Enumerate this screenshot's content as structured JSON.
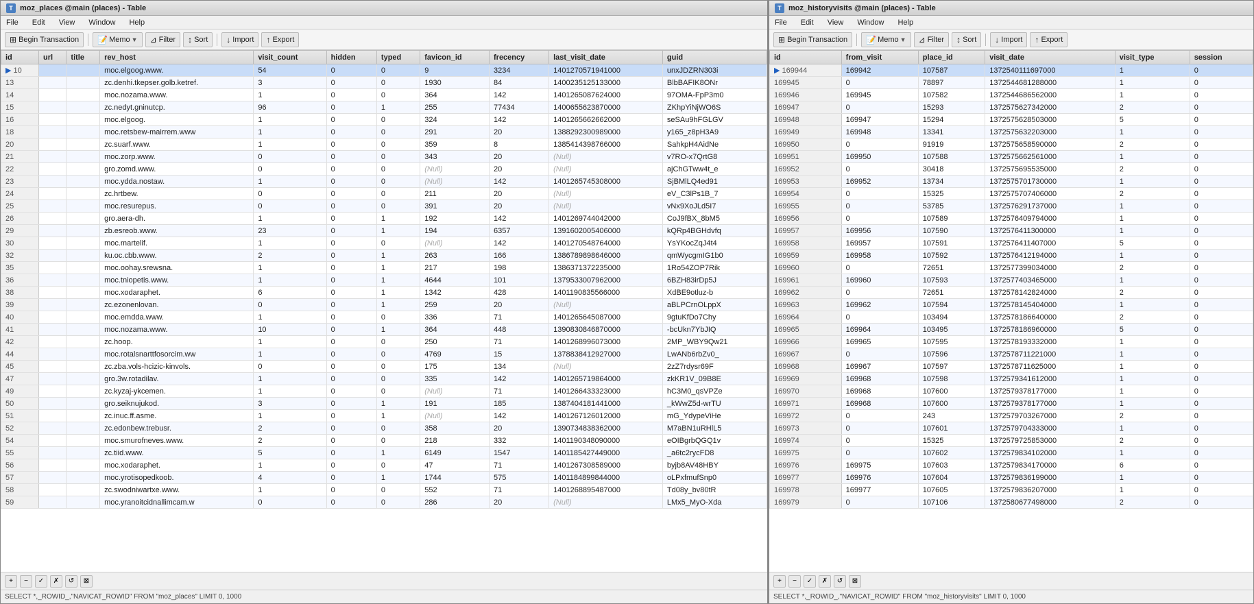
{
  "leftWindow": {
    "title": "moz_places @main (places) - Table",
    "menu": [
      "File",
      "Edit",
      "View",
      "Window",
      "Help"
    ],
    "toolbar": {
      "beginTransaction": "Begin Transaction",
      "memo": "Memo",
      "filter": "Filter",
      "sort": "Sort",
      "import": "Import",
      "export": "Export"
    },
    "columns": [
      "id",
      "url",
      "title",
      "rev_host",
      "visit_count",
      "hidden",
      "typed",
      "favicon_id",
      "frecency",
      "last_visit_date",
      "guid"
    ],
    "rows": [
      [
        "10",
        "",
        "",
        "moc.elgoog.www.",
        "54",
        "0",
        "0",
        "9",
        "3234",
        "1401270571941000",
        "unxJDZRN303i"
      ],
      [
        "13",
        "",
        "",
        "zc.denhi.tkepser.golb.ketref.",
        "3",
        "0",
        "0",
        "1930",
        "84",
        "1400235125133000",
        "BlbBAFIK8ONr"
      ],
      [
        "14",
        "",
        "",
        "moc.nozama.www.",
        "1",
        "0",
        "0",
        "364",
        "142",
        "1401265087624000",
        "97OMA-FpP3m0"
      ],
      [
        "15",
        "",
        "",
        "zc.nedyt.gninutcp.",
        "96",
        "0",
        "1",
        "255",
        "77434",
        "1400655623870000",
        "ZKhpYiNjWO6S"
      ],
      [
        "16",
        "",
        "",
        "moc.elgoog.",
        "1",
        "0",
        "0",
        "324",
        "142",
        "1401265662662000",
        "seSAu9hFGLGV"
      ],
      [
        "18",
        "",
        "",
        "moc.retsbew-mairrem.www",
        "1",
        "0",
        "0",
        "291",
        "20",
        "1388292300989000",
        "y165_z8pH3A9"
      ],
      [
        "20",
        "",
        "",
        "zc.suarf.www.",
        "1",
        "0",
        "0",
        "359",
        "8",
        "1385414398766000",
        "SahkpH4AidNe"
      ],
      [
        "21",
        "",
        "",
        "moc.zorp.www.",
        "0",
        "0",
        "0",
        "343",
        "20",
        "(Null)",
        "v7RO-x7QrtG8"
      ],
      [
        "22",
        "",
        "",
        "gro.zomd.www.",
        "0",
        "0",
        "0",
        "(Null)",
        "20",
        "(Null)",
        "ajChGTww4t_e"
      ],
      [
        "23",
        "",
        "",
        "moc.ydda.nostaw.",
        "1",
        "0",
        "0",
        "(Null)",
        "142",
        "1401265745308000",
        "SjBMlLQ4ed91"
      ],
      [
        "24",
        "",
        "",
        "zc.hrtbew.",
        "0",
        "0",
        "0",
        "211",
        "20",
        "(Null)",
        "eV_C3lPs1B_7"
      ],
      [
        "25",
        "",
        "",
        "moc.resurepus.",
        "0",
        "0",
        "0",
        "391",
        "20",
        "(Null)",
        "vNx9XoJLd5I7"
      ],
      [
        "26",
        "",
        "",
        "gro.aera-dh.",
        "1",
        "0",
        "1",
        "192",
        "142",
        "1401269744042000",
        "CoJ9fBX_8bM5"
      ],
      [
        "29",
        "",
        "",
        "zb.esreob.www.",
        "23",
        "0",
        "1",
        "194",
        "6357",
        "1391602005406000",
        "kQRp4BGHdvfq"
      ],
      [
        "30",
        "",
        "",
        "moc.martelif.",
        "1",
        "0",
        "0",
        "(Null)",
        "142",
        "1401270548764000",
        "YsYKocZqJ4t4"
      ],
      [
        "32",
        "",
        "",
        "ku.oc.cbb.www.",
        "2",
        "0",
        "1",
        "263",
        "166",
        "1386789898646000",
        "qmWycgmIG1b0"
      ],
      [
        "35",
        "",
        "",
        "moc.oohay.srewsna.",
        "1",
        "0",
        "1",
        "217",
        "198",
        "1386371372235000",
        "1Ro54ZOP7Rik"
      ],
      [
        "36",
        "",
        "",
        "moc.tniopetis.www.",
        "1",
        "0",
        "1",
        "4644",
        "101",
        "1379533007962000",
        "6BZH83irDp5J"
      ],
      [
        "38",
        "",
        "",
        "moc.xodaraphet.",
        "6",
        "0",
        "1",
        "1342",
        "428",
        "1401190835566000",
        "XdBE9otluz-b"
      ],
      [
        "39",
        "",
        "",
        "zc.ezonenlovan.",
        "0",
        "0",
        "1",
        "259",
        "20",
        "(Null)",
        "aBLPCrnOLppX"
      ],
      [
        "40",
        "",
        "",
        "moc.emdda.www.",
        "1",
        "0",
        "0",
        "336",
        "71",
        "1401265645087000",
        "9gtuKfDo7Chy"
      ],
      [
        "41",
        "",
        "",
        "moc.nozama.www.",
        "10",
        "0",
        "1",
        "364",
        "448",
        "1390830846870000",
        "-bcUkn7YbJIQ"
      ],
      [
        "42",
        "",
        "",
        "zc.hoop.",
        "1",
        "0",
        "0",
        "250",
        "71",
        "1401268996073000",
        "2MP_WBY9Qw21"
      ],
      [
        "44",
        "",
        "",
        "moc.rotalsnarttfosorcim.ww",
        "1",
        "0",
        "0",
        "4769",
        "15",
        "1378838412927000",
        "LwANb6rbZv0_"
      ],
      [
        "45",
        "",
        "",
        "zc.zba.vols-hcizic-kinvols.",
        "0",
        "0",
        "0",
        "175",
        "134",
        "(Null)",
        "2zZ7rdysr69F"
      ],
      [
        "47",
        "",
        "",
        "gro.3w.rotadilav.",
        "1",
        "0",
        "0",
        "335",
        "142",
        "1401265719864000",
        "zkKR1V_09B8E"
      ],
      [
        "49",
        "",
        "",
        "zc.kyzaj-ykcemen.",
        "1",
        "0",
        "0",
        "(Null)",
        "71",
        "1401266433323000",
        "hC3M0_qsVPZe"
      ],
      [
        "50",
        "",
        "",
        "gro.seiknujukod.",
        "3",
        "0",
        "1",
        "191",
        "185",
        "1387404181441000",
        "_kWwZ5d-wrTU"
      ],
      [
        "51",
        "",
        "",
        "zc.inuc.ff.asme.",
        "1",
        "0",
        "1",
        "(Null)",
        "142",
        "1401267126012000",
        "mG_YdypeViHe"
      ],
      [
        "52",
        "",
        "",
        "zc.edonbew.trebusr.",
        "2",
        "0",
        "0",
        "358",
        "20",
        "1390734838362000",
        "M7aBN1uRHlL5"
      ],
      [
        "54",
        "",
        "",
        "moc.smurofneves.www.",
        "2",
        "0",
        "0",
        "218",
        "332",
        "1401190348090000",
        "eOIBgrbQGQ1v"
      ],
      [
        "55",
        "",
        "",
        "zc.tiid.www.",
        "5",
        "0",
        "1",
        "6149",
        "1547",
        "1401185427449000",
        "_a6tc2rycFD8"
      ],
      [
        "56",
        "",
        "",
        "moc.xodaraphet.",
        "1",
        "0",
        "0",
        "47",
        "71",
        "1401267308589000",
        "byjb8AV48HBY"
      ],
      [
        "57",
        "",
        "",
        "moc.yrotisopedkoob.",
        "4",
        "0",
        "1",
        "1744",
        "575",
        "1401184899844000",
        "oLPxfmufSnp0"
      ],
      [
        "58",
        "",
        "",
        "zc.swodniwartxe.www.",
        "1",
        "0",
        "0",
        "552",
        "71",
        "1401268895487000",
        "Td08y_bv80tR"
      ],
      [
        "59",
        "",
        "",
        "moc.yranoitcidnallimcam.w",
        "0",
        "0",
        "0",
        "286",
        "20",
        "(Null)",
        "LMx5_MyO-Xda"
      ]
    ],
    "statusBar": "SELECT *,_ROWID_,\"NAVICAT_ROWID\" FROM \"moz_places\" LIMIT 0, 1000"
  },
  "rightWindow": {
    "title": "moz_historyvisits @main (places) - Table",
    "menu": [
      "File",
      "Edit",
      "View",
      "Window",
      "Help"
    ],
    "toolbar": {
      "beginTransaction": "Begin Transaction",
      "memo": "Memo",
      "filter": "Filter",
      "sort": "Sort",
      "import": "Import",
      "export": "Export"
    },
    "columns": [
      "id",
      "from_visit",
      "place_id",
      "visit_date",
      "visit_type",
      "session"
    ],
    "rows": [
      [
        "169944",
        "169942",
        "107587",
        "1372540111697000",
        "1",
        "0"
      ],
      [
        "169945",
        "0",
        "78897",
        "1372544681288000",
        "1",
        "0"
      ],
      [
        "169946",
        "169945",
        "107582",
        "1372544686562000",
        "1",
        "0"
      ],
      [
        "169947",
        "0",
        "15293",
        "1372575627342000",
        "2",
        "0"
      ],
      [
        "169948",
        "169947",
        "15294",
        "1372575628503000",
        "5",
        "0"
      ],
      [
        "169949",
        "169948",
        "13341",
        "1372575632203000",
        "1",
        "0"
      ],
      [
        "169950",
        "0",
        "91919",
        "1372575658590000",
        "2",
        "0"
      ],
      [
        "169951",
        "169950",
        "107588",
        "1372575662561000",
        "1",
        "0"
      ],
      [
        "169952",
        "0",
        "30418",
        "1372575695535000",
        "2",
        "0"
      ],
      [
        "169953",
        "169952",
        "13734",
        "1372575701730000",
        "1",
        "0"
      ],
      [
        "169954",
        "0",
        "15325",
        "1372575707406000",
        "2",
        "0"
      ],
      [
        "169955",
        "0",
        "53785",
        "1372576291737000",
        "1",
        "0"
      ],
      [
        "169956",
        "0",
        "107589",
        "1372576409794000",
        "1",
        "0"
      ],
      [
        "169957",
        "169956",
        "107590",
        "1372576411300000",
        "1",
        "0"
      ],
      [
        "169958",
        "169957",
        "107591",
        "1372576411407000",
        "5",
        "0"
      ],
      [
        "169959",
        "169958",
        "107592",
        "1372576412194000",
        "1",
        "0"
      ],
      [
        "169960",
        "0",
        "72651",
        "1372577399034000",
        "2",
        "0"
      ],
      [
        "169961",
        "169960",
        "107593",
        "1372577403465000",
        "1",
        "0"
      ],
      [
        "169962",
        "0",
        "72651",
        "1372578142824000",
        "2",
        "0"
      ],
      [
        "169963",
        "169962",
        "107594",
        "1372578145404000",
        "1",
        "0"
      ],
      [
        "169964",
        "0",
        "103494",
        "1372578186640000",
        "2",
        "0"
      ],
      [
        "169965",
        "169964",
        "103495",
        "1372578186960000",
        "5",
        "0"
      ],
      [
        "169966",
        "169965",
        "107595",
        "1372578193332000",
        "1",
        "0"
      ],
      [
        "169967",
        "0",
        "107596",
        "1372578711221000",
        "1",
        "0"
      ],
      [
        "169968",
        "169967",
        "107597",
        "1372578711625000",
        "1",
        "0"
      ],
      [
        "169969",
        "169968",
        "107598",
        "1372579341612000",
        "1",
        "0"
      ],
      [
        "169970",
        "169968",
        "107600",
        "1372579378177000",
        "1",
        "0"
      ],
      [
        "169971",
        "169968",
        "107600",
        "1372579378177000",
        "1",
        "0"
      ],
      [
        "169972",
        "0",
        "243",
        "1372579703267000",
        "2",
        "0"
      ],
      [
        "169973",
        "0",
        "107601",
        "1372579704333000",
        "1",
        "0"
      ],
      [
        "169974",
        "0",
        "15325",
        "1372579725853000",
        "2",
        "0"
      ],
      [
        "169975",
        "0",
        "107602",
        "1372579834102000",
        "1",
        "0"
      ],
      [
        "169976",
        "169975",
        "107603",
        "1372579834170000",
        "6",
        "0"
      ],
      [
        "169977",
        "169976",
        "107604",
        "1372579836199000",
        "1",
        "0"
      ],
      [
        "169978",
        "169977",
        "107605",
        "1372579836207000",
        "1",
        "0"
      ],
      [
        "169979",
        "0",
        "107106",
        "1372580677498000",
        "2",
        "0"
      ]
    ],
    "statusBar": "SELECT *,_ROWID_,\"NAVICAT_ROWID\" FROM \"moz_historyvisits\" LIMIT 0, 1000"
  }
}
